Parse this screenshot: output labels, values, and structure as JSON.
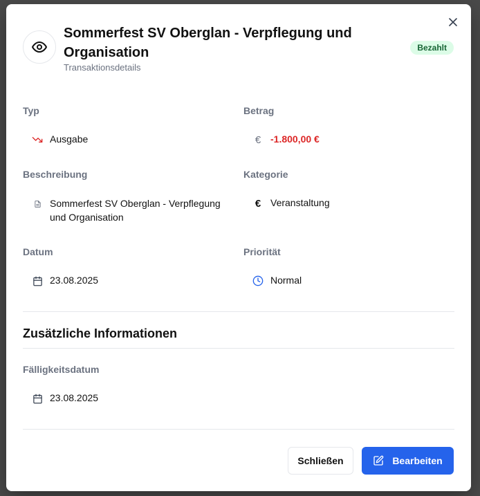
{
  "modal": {
    "title": "Sommerfest SV Oberglan - Verpflegung und Organisation",
    "subtitle": "Transaktionsdetails",
    "status_badge": "Bezahlt",
    "status_color": "#166534",
    "icon": "eye-icon"
  },
  "fields": {
    "typ": {
      "label": "Typ",
      "value": "Ausgabe",
      "icon": "trending-down-icon",
      "color": "#dc2626"
    },
    "betrag": {
      "label": "Betrag",
      "value": "-1.800,00 €",
      "icon": "euro-icon",
      "color": "#dc2626"
    },
    "beschreibung": {
      "label": "Beschreibung",
      "value": "Sommerfest SV Oberglan - Verpflegung und Organisation",
      "icon": "file-text-icon"
    },
    "kategorie": {
      "label": "Kategorie",
      "value": "Veranstaltung",
      "icon": "euro-icon"
    },
    "datum": {
      "label": "Datum",
      "value": "23.08.2025",
      "icon": "calendar-icon"
    },
    "prioritaet": {
      "label": "Priorität",
      "value": "Normal",
      "icon": "clock-icon",
      "color": "#2563eb"
    }
  },
  "additional": {
    "title": "Zusätzliche Informationen",
    "faelligkeitsdatum": {
      "label": "Fälligkeitsdatum",
      "value": "23.08.2025",
      "icon": "calendar-icon"
    }
  },
  "footer": {
    "close_label": "Schließen",
    "edit_label": "Bearbeiten",
    "accent": "#2563eb"
  }
}
